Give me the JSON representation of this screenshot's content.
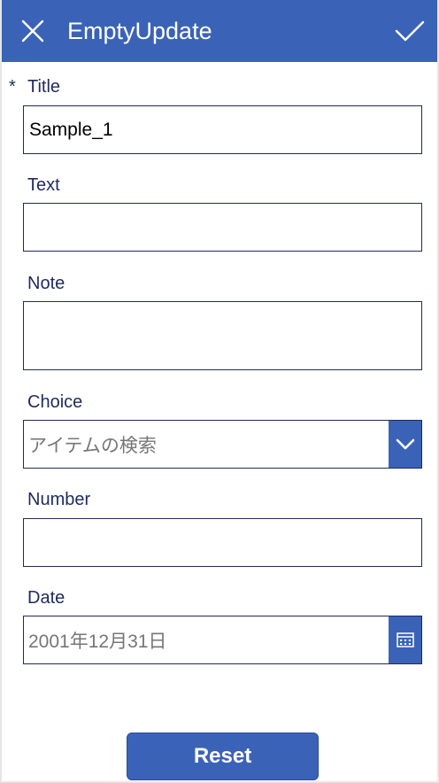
{
  "header": {
    "title": "EmptyUpdate",
    "close_icon": "close-icon",
    "submit_icon": "checkmark-icon"
  },
  "form": {
    "title_field": {
      "required_marker": "*",
      "label": "Title",
      "value": "Sample_1"
    },
    "text_field": {
      "label": "Text",
      "value": ""
    },
    "note_field": {
      "label": "Note",
      "value": ""
    },
    "choice_field": {
      "label": "Choice",
      "placeholder": "アイテムの検索",
      "icon": "chevron-down-icon"
    },
    "number_field": {
      "label": "Number",
      "value": ""
    },
    "date_field": {
      "label": "Date",
      "placeholder": "2001年12月31日",
      "icon": "calendar-icon"
    }
  },
  "actions": {
    "reset_label": "Reset"
  },
  "colors": {
    "accent": "#3a63b8",
    "label_text": "#1f2a5c",
    "border": "#1f2a5c",
    "placeholder_text": "#767676"
  }
}
